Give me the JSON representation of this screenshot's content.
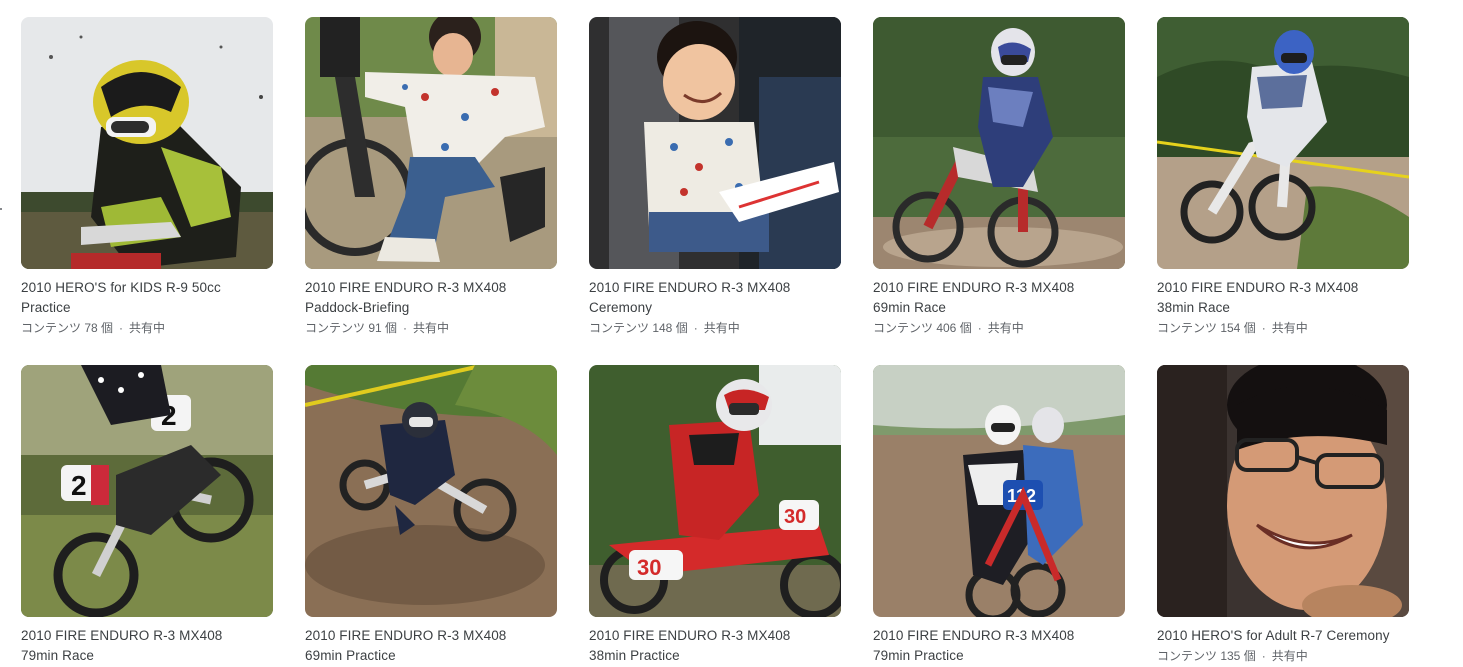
{
  "albums": [
    {
      "title": "2010 HERO'S for KIDS R-9 50cc",
      "subtitle": "Practice",
      "count_label": "コンテンツ 78 個",
      "shared_label": "共有中",
      "thumb_icon": "rider-yellow-helmet-photo"
    },
    {
      "title": "2010 FIRE ENDURO R-3 MX408",
      "subtitle": "Paddock-Briefing",
      "count_label": "コンテンツ 91 個",
      "shared_label": "共有中",
      "thumb_icon": "child-climbing-bike-photo"
    },
    {
      "title": "2010 FIRE ENDURO R-3 MX408",
      "subtitle": "Ceremony",
      "count_label": "コンテンツ 148 個",
      "shared_label": "共有中",
      "thumb_icon": "smiling-child-photo"
    },
    {
      "title": "2010 FIRE ENDURO R-3 MX408",
      "subtitle": "69min Race",
      "count_label": "コンテンツ 406 個",
      "shared_label": "共有中",
      "thumb_icon": "motocross-rider-photo"
    },
    {
      "title": "2010 FIRE ENDURO R-3 MX408",
      "subtitle": "38min Race",
      "count_label": "コンテンツ 154 個",
      "shared_label": "共有中",
      "thumb_icon": "motocross-rider-31-photo"
    },
    {
      "title": "2010 FIRE ENDURO R-3 MX408",
      "subtitle": "79min Race",
      "count_label": "",
      "shared_label": "",
      "thumb_icon": "jumping-bike-2-photo"
    },
    {
      "title": "2010 FIRE ENDURO R-3 MX408",
      "subtitle": "69min Practice",
      "count_label": "",
      "shared_label": "",
      "thumb_icon": "cornering-rider-photo"
    },
    {
      "title": "2010 FIRE ENDURO R-3 MX408",
      "subtitle": "38min Practice",
      "count_label": "",
      "shared_label": "",
      "thumb_icon": "red-honda-30-photo"
    },
    {
      "title": "2010 FIRE ENDURO R-3 MX408",
      "subtitle": "79min Practice",
      "count_label": "",
      "shared_label": "",
      "thumb_icon": "two-riders-photo"
    },
    {
      "title": "2010 HERO'S for Adult R-7 Ceremony",
      "subtitle": "",
      "count_label": "コンテンツ 135 個",
      "shared_label": "共有中",
      "thumb_icon": "smiling-man-glasses-photo"
    }
  ],
  "separator": "·"
}
